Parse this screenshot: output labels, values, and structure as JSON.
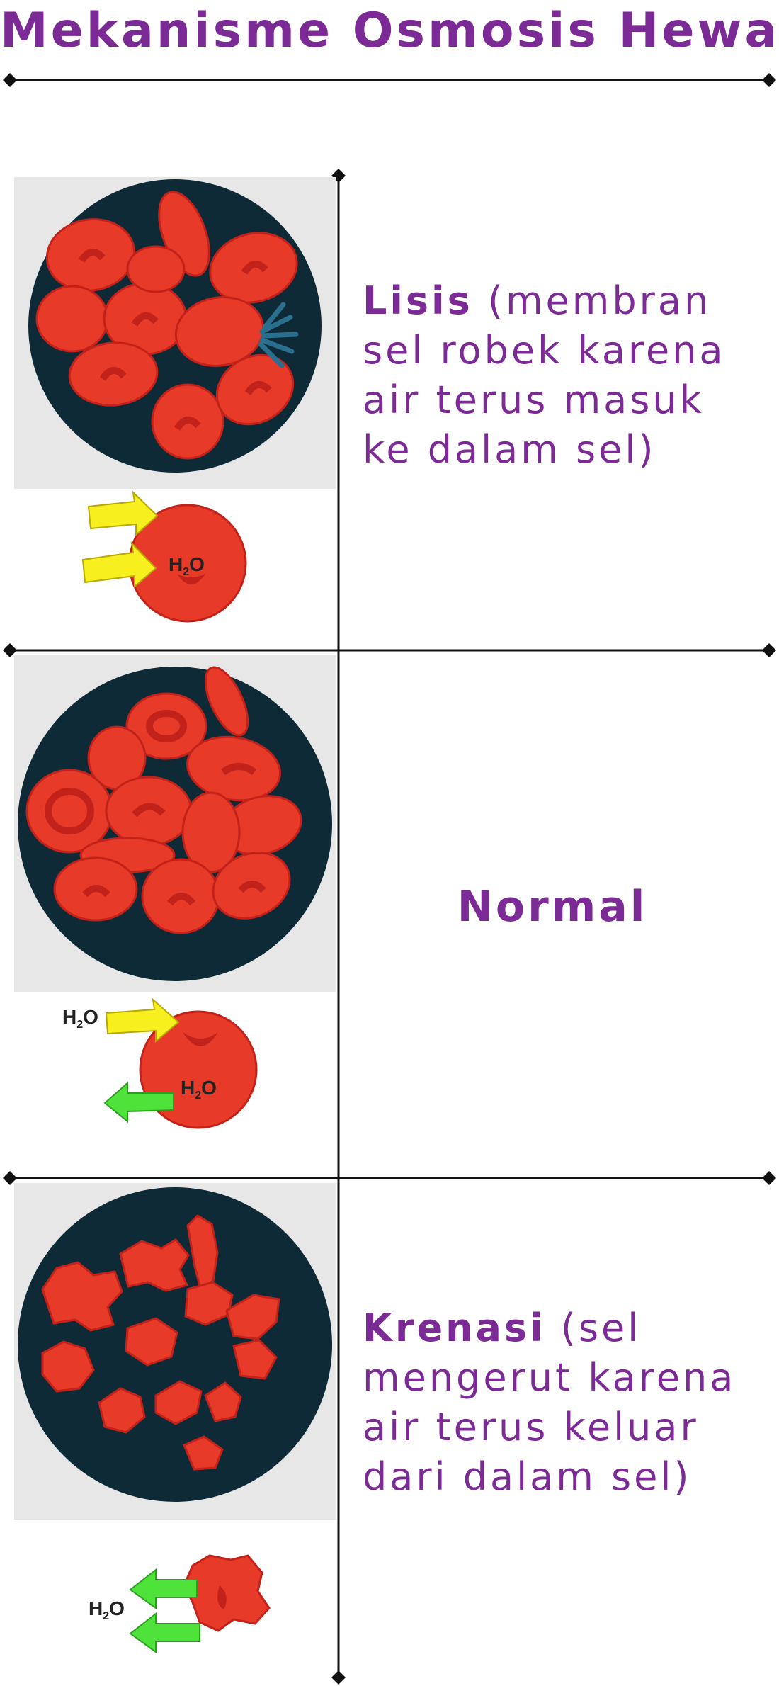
{
  "title": "Mekanisme Osmosis Hewan",
  "colors": {
    "title": "#7B2A96",
    "description": "#7B2A96",
    "divider": "#111111",
    "panel_bg": "#E7E7E7",
    "dish": "#0F2A37",
    "cell": "#E83A28",
    "cell_dark": "#C2221A",
    "water_in_arrow": "#F7F01E",
    "water_out_arrow": "#4FE23A"
  },
  "icons": {
    "lysis": "swollen-blood-cells-icon",
    "normal": "normal-blood-cells-icon",
    "crenation": "shrunken-blood-cells-icon",
    "arrow_in": "water-in-arrow-icon",
    "arrow_out": "water-out-arrow-icon"
  },
  "rows": {
    "lysis": {
      "label": "Lisis",
      "detail": "(membran sel robek karena air terus masuk ke dalam sel)",
      "cell_label": "H",
      "cell_sub": "2",
      "cell_label_end": "O"
    },
    "normal": {
      "label": "Normal",
      "outside_label": "H",
      "outside_sub": "2",
      "outside_end": "O",
      "cell_label": "H",
      "cell_sub": "2",
      "cell_label_end": "O"
    },
    "crenation": {
      "label": "Krenasi",
      "detail": "(sel mengerut karena air terus keluar dari dalam sel)",
      "outside_label": "H",
      "outside_sub": "2",
      "outside_end": "O"
    }
  }
}
